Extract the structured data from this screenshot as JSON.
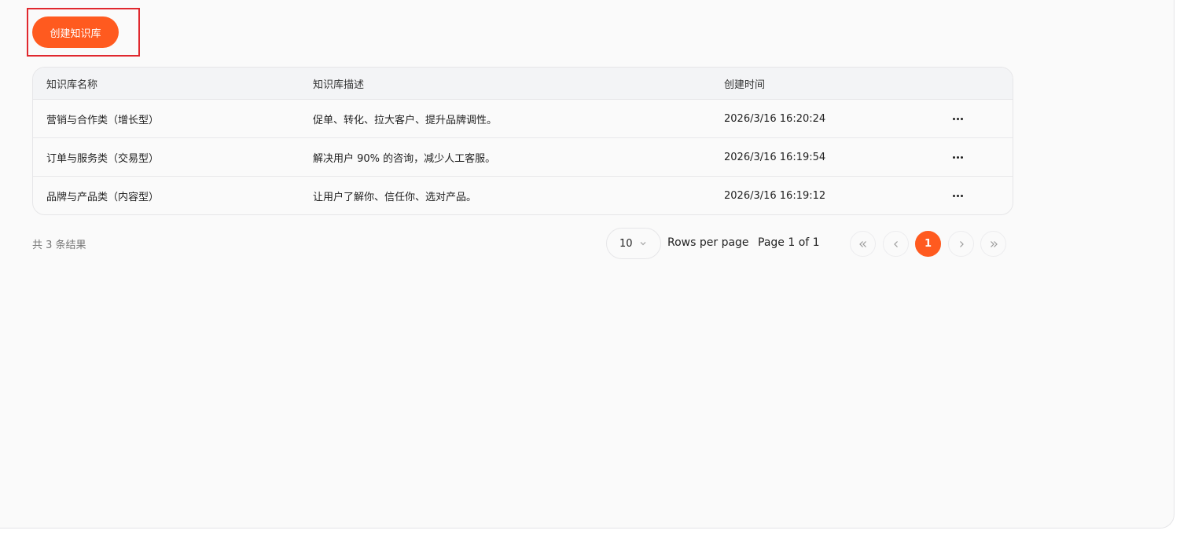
{
  "toolbar": {
    "create_label": "创建知识库"
  },
  "table": {
    "headers": {
      "name": "知识库名称",
      "description": "知识库描述",
      "created_at": "创建时间"
    },
    "rows": [
      {
        "name": "营销与合作类（增长型）",
        "description": "促单、转化、拉大客户、提升品牌调性。",
        "created_at": "2026/3/16 16:20:24",
        "actions_icon": "more-horizontal-icon"
      },
      {
        "name": "订单与服务类（交易型）",
        "description": "解决用户 90% 的咨询，减少人工客服。",
        "created_at": "2026/3/16 16:19:54",
        "actions_icon": "more-horizontal-icon"
      },
      {
        "name": "品牌与产品类（内容型）",
        "description": "让用户了解你、信任你、选对产品。",
        "created_at": "2026/3/16 16:19:12",
        "actions_icon": "more-horizontal-icon"
      }
    ]
  },
  "pagination": {
    "total_text": "共 3 条结果",
    "page_size": "10",
    "rows_per_page_label": "Rows per page",
    "page_info": "Page 1 of 1",
    "current_page": "1"
  },
  "colors": {
    "accent": "#ff5a1f",
    "highlight_border": "#e0282e",
    "background": "#fafafa"
  }
}
